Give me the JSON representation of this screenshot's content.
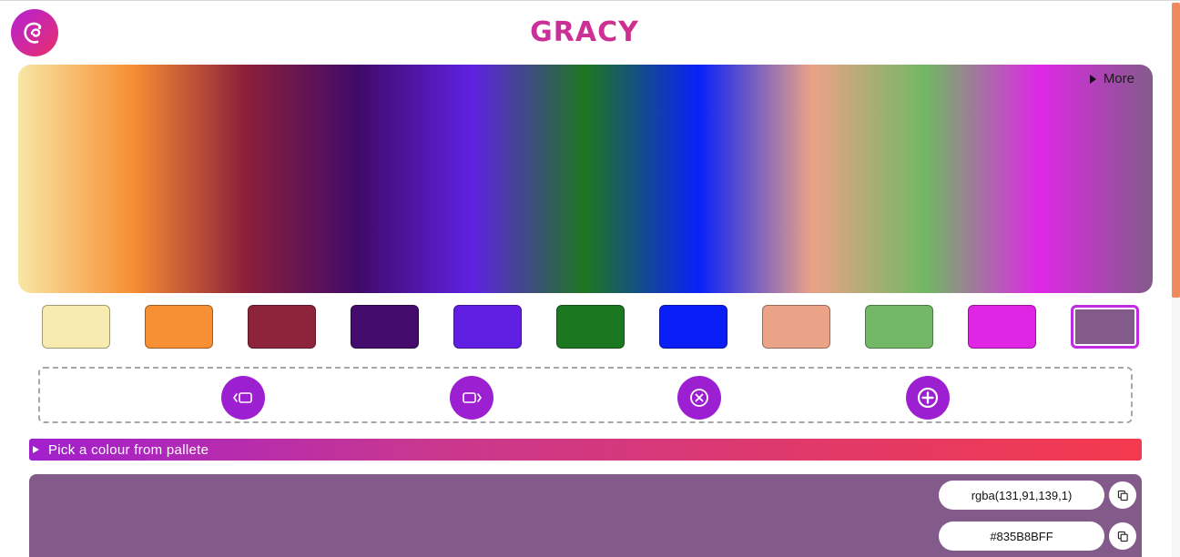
{
  "app": {
    "title": "GRACY",
    "logo_icon": "chameleon-logo-icon"
  },
  "gradient": {
    "stops": [
      "#F8E6A5",
      "#F78F34",
      "#8C203A",
      "#400A6A",
      "#5F21E2",
      "#1E7720",
      "#0920F9",
      "#EBA287",
      "#71B863",
      "#DF27E6",
      "#835B8B"
    ],
    "more_label": "More"
  },
  "palette": {
    "swatches": [
      "#F8EBB0",
      "#F78F34",
      "#8E233C",
      "#430C6C",
      "#601FE2",
      "#1C7721",
      "#0A1FF8",
      "#EBA387",
      "#72B866",
      "#DE26E4",
      "#835B8B"
    ],
    "selected_index": 10
  },
  "toolbar": {
    "buttons": [
      {
        "name": "move-left-button",
        "icon": "move-left-icon"
      },
      {
        "name": "move-right-button",
        "icon": "move-right-icon"
      },
      {
        "name": "remove-colour-button",
        "icon": "close-circle-icon"
      },
      {
        "name": "add-colour-button",
        "icon": "plus-circle-icon"
      }
    ]
  },
  "picker": {
    "label": "Pick a colour from pallete"
  },
  "preview": {
    "color": "#835B8B",
    "rgba": "rgba(131,91,139,1)",
    "hex": "#835B8BFF",
    "copy_icon": "copy-icon"
  },
  "colors": {
    "accent": "#9C1FD2",
    "brand_gradient_start": "#A21FCE",
    "brand_gradient_end": "#F43A4E"
  }
}
